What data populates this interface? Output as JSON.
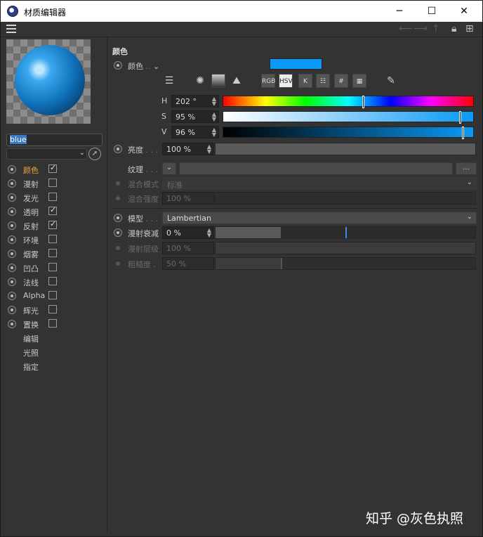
{
  "window": {
    "title": "材质编辑器",
    "minimize": "─",
    "maximize": "☐",
    "close": "✕"
  },
  "toolbar": {
    "icons": [
      "back-arrow-icon",
      "forward-arrow-icon",
      "up-arrow-icon",
      "lock-icon",
      "new-panel-icon"
    ]
  },
  "material": {
    "name": "blue",
    "channels": [
      {
        "label": "颜色",
        "checkbox": true,
        "checked": true,
        "active": true
      },
      {
        "label": "漫射",
        "checkbox": true,
        "checked": false
      },
      {
        "label": "发光",
        "checkbox": true,
        "checked": false
      },
      {
        "label": "透明",
        "checkbox": true,
        "checked": true
      },
      {
        "label": "反射",
        "checkbox": true,
        "checked": true
      },
      {
        "label": "环境",
        "checkbox": true,
        "checked": false
      },
      {
        "label": "烟雾",
        "checkbox": true,
        "checked": false
      },
      {
        "label": "凹凸",
        "checkbox": true,
        "checked": false
      },
      {
        "label": "法线",
        "checkbox": true,
        "checked": false
      },
      {
        "label": "Alpha",
        "checkbox": true,
        "checked": false
      },
      {
        "label": "辉光",
        "checkbox": true,
        "checked": false
      },
      {
        "label": "置换",
        "checkbox": true,
        "checked": false
      },
      {
        "label": "编辑",
        "checkbox": false
      },
      {
        "label": "光照",
        "checkbox": false
      },
      {
        "label": "指定",
        "checkbox": false
      }
    ]
  },
  "color_section": {
    "title": "颜色",
    "color_label": "颜色",
    "color_hex": "#0a99f5",
    "modes": {
      "rgb": "RGB",
      "hsv": "HSV",
      "k": "K",
      "hash": "#"
    },
    "h": {
      "label": "H",
      "value": "202 °",
      "fraction": 0.561
    },
    "s": {
      "label": "S",
      "value": "95 %",
      "fraction": 0.95
    },
    "v": {
      "label": "V",
      "value": "96 %",
      "fraction": 0.96
    },
    "brightness": {
      "label": "亮度",
      "value": "100 %",
      "fraction": 1.0
    },
    "texture": {
      "label": "纹理",
      "more": "..."
    },
    "blend_mode": {
      "label": "混合模式",
      "value": "标准"
    },
    "blend_strength": {
      "label": "混合强度",
      "value": "100 %"
    }
  },
  "model_section": {
    "model": {
      "label": "模型",
      "value": "Lambertian"
    },
    "diffuse_falloff": {
      "label": "漫射衰减",
      "value": "0 %",
      "fraction": 0.5
    },
    "diffuse_level": {
      "label": "漫射层级",
      "value": "100 %",
      "fraction": 1.0
    },
    "roughness": {
      "label": "粗糙度",
      "value": "50 %",
      "fraction": 0.25
    }
  },
  "watermark": "知乎 @灰色执照"
}
